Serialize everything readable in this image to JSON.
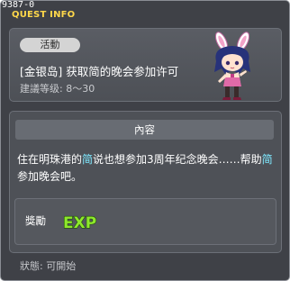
{
  "window": {
    "quest_id": "9387-0",
    "title": "QUEST INFO"
  },
  "quest": {
    "badge": "活動",
    "name": "[金银岛] 获取简的晚会参加许可",
    "level": "建議等级: 8〜30"
  },
  "content": {
    "header": "內容",
    "description": [
      {
        "text": "住在明珠港的",
        "highlight": false
      },
      {
        "text": "简",
        "highlight": true
      },
      {
        "text": "说也想参加3周年纪念晚会……帮助",
        "highlight": false
      },
      {
        "text": "简",
        "highlight": true
      },
      {
        "text": "参加晚会吧。",
        "highlight": false
      }
    ]
  },
  "reward": {
    "label": "獎勵",
    "exp_icon": "EXP"
  },
  "status": "狀態: 可開始",
  "colors": {
    "title": "#ffd84a",
    "highlight": "#7fe9ff",
    "exp_green": "#8ee82c"
  },
  "icons": {
    "npc": "npc-bunny-girl-icon",
    "exp": "exp-icon"
  }
}
